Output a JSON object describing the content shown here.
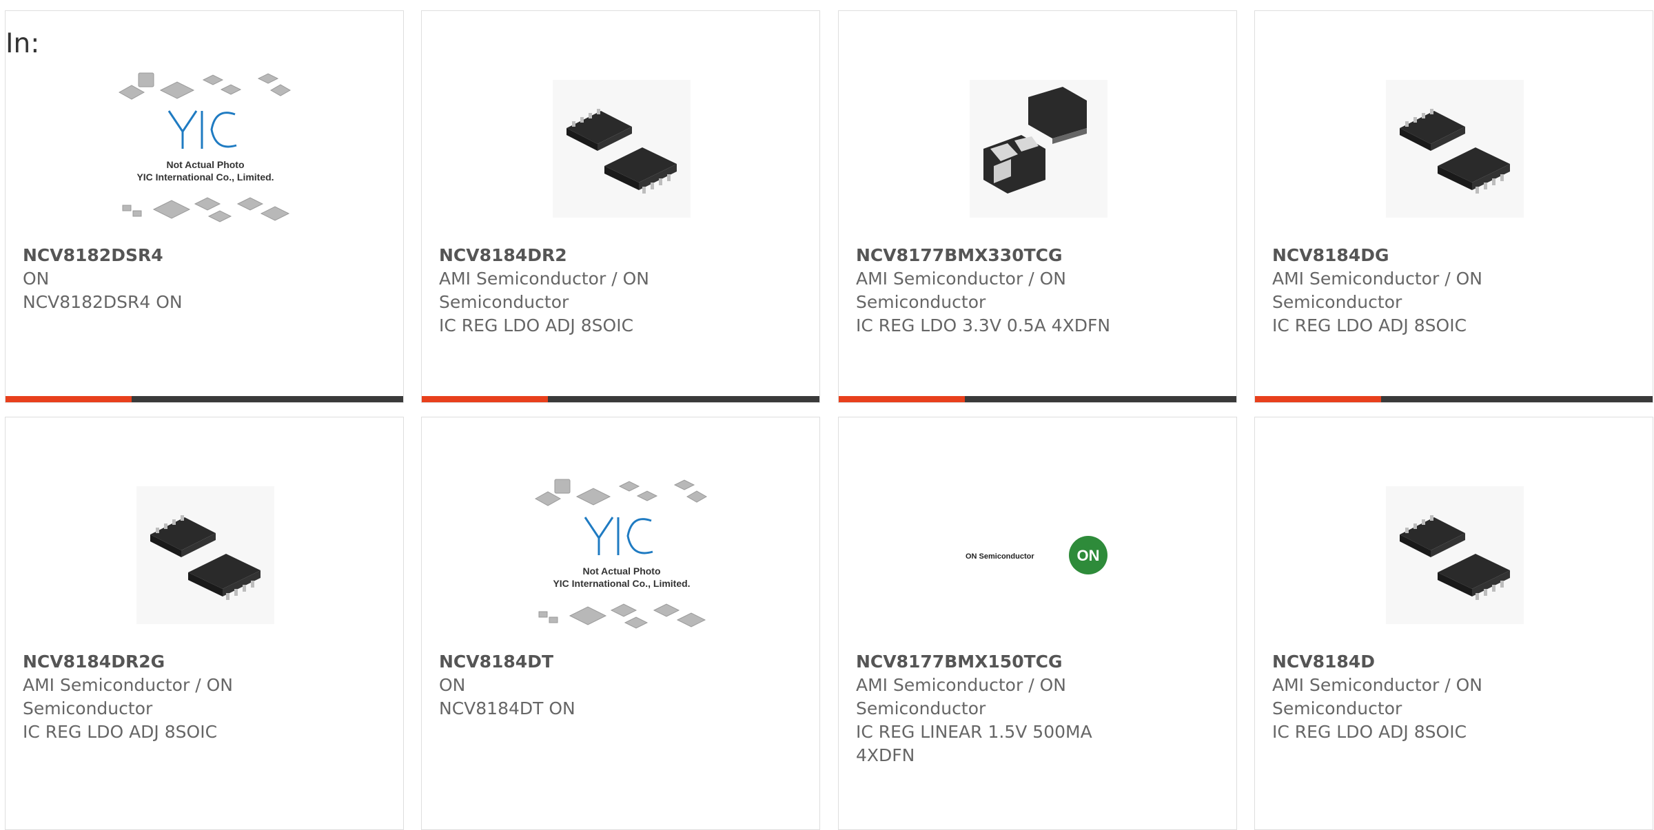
{
  "header": {
    "label": "In:"
  },
  "colors": {
    "accent": "#e8401c",
    "bar": "#3a3a3a",
    "text": "#666666",
    "title": "#555555"
  },
  "placeholder": {
    "logo": "YIC",
    "line1": "Not Actual Photo",
    "line2": "YIC International Co., Limited."
  },
  "on_logo": {
    "wordmark": "ON Semiconductor",
    "badge": "ON"
  },
  "products": [
    {
      "part": "NCV8182DSR4",
      "maker1": "ON",
      "maker2": "",
      "desc": "NCV8182DSR4 ON",
      "desc2": "",
      "image": "yic-placeholder"
    },
    {
      "part": "NCV8184DR2",
      "maker1": "AMI Semiconductor / ON",
      "maker2": "Semiconductor",
      "desc": "IC REG LDO ADJ 8SOIC",
      "desc2": "",
      "image": "soic-chips"
    },
    {
      "part": "NCV8177BMX330TCG",
      "maker1": "AMI Semiconductor / ON",
      "maker2": "Semiconductor",
      "desc": "IC REG LDO 3.3V 0.5A 4XDFN",
      "desc2": "",
      "image": "xdfn-chips"
    },
    {
      "part": "NCV8184DG",
      "maker1": "AMI Semiconductor / ON",
      "maker2": "Semiconductor",
      "desc": "IC REG LDO ADJ 8SOIC",
      "desc2": "",
      "image": "soic-chips"
    },
    {
      "part": "NCV8184DR2G",
      "maker1": "AMI Semiconductor / ON",
      "maker2": "Semiconductor",
      "desc": "IC REG LDO ADJ 8SOIC",
      "desc2": "",
      "image": "soic-chips"
    },
    {
      "part": "NCV8184DT",
      "maker1": "ON",
      "maker2": "",
      "desc": "NCV8184DT ON",
      "desc2": "",
      "image": "yic-placeholder"
    },
    {
      "part": "NCV8177BMX150TCG",
      "maker1": "AMI Semiconductor / ON",
      "maker2": "Semiconductor",
      "desc": "IC REG LINEAR 1.5V 500MA",
      "desc2": "4XDFN",
      "image": "on-logo"
    },
    {
      "part": "NCV8184D",
      "maker1": "AMI Semiconductor / ON",
      "maker2": "Semiconductor",
      "desc": "IC REG LDO ADJ 8SOIC",
      "desc2": "",
      "image": "soic-chips"
    }
  ]
}
